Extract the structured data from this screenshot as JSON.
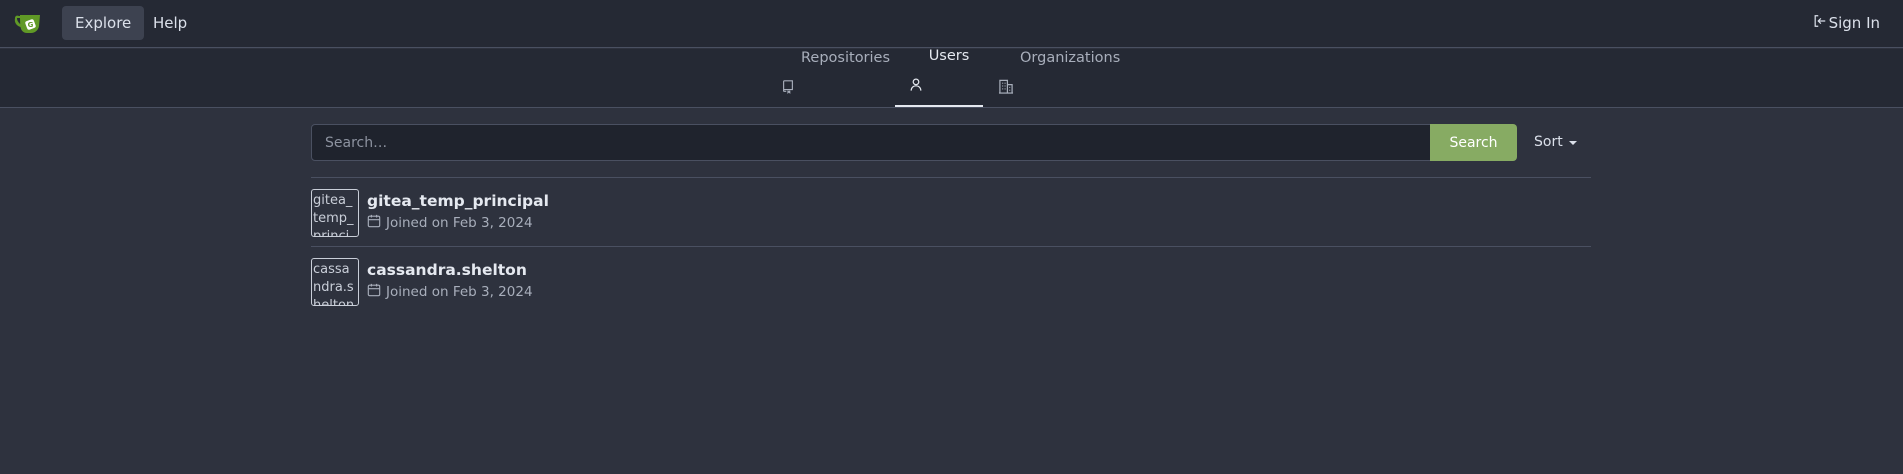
{
  "nav": {
    "logo_icon": "gitea-teacup-icon",
    "explore_label": "Explore",
    "help_label": "Help",
    "signin_label": "Sign In",
    "signin_icon": "sign-in-icon"
  },
  "tabs": [
    {
      "label": "Repositories",
      "icon": "repo-icon",
      "active": false
    },
    {
      "label": "Users",
      "icon": "person-icon",
      "active": true
    },
    {
      "label": "Organizations",
      "icon": "organization-icon",
      "active": false
    }
  ],
  "search": {
    "placeholder": "Search…",
    "value": "",
    "button_label": "Search",
    "sort_label": "Sort"
  },
  "users": [
    {
      "name": "gitea_temp_principal",
      "avatar_alt": "gitea_temp_principal",
      "joined": "Joined on Feb 3, 2024"
    },
    {
      "name": "cassandra.shelton",
      "avatar_alt": "cassandra.shelton",
      "joined": "Joined on Feb 3, 2024"
    }
  ],
  "colors": {
    "background": "#2e323e",
    "navbar": "#252934",
    "accent": "#87ab63",
    "border": "#4a5061"
  }
}
